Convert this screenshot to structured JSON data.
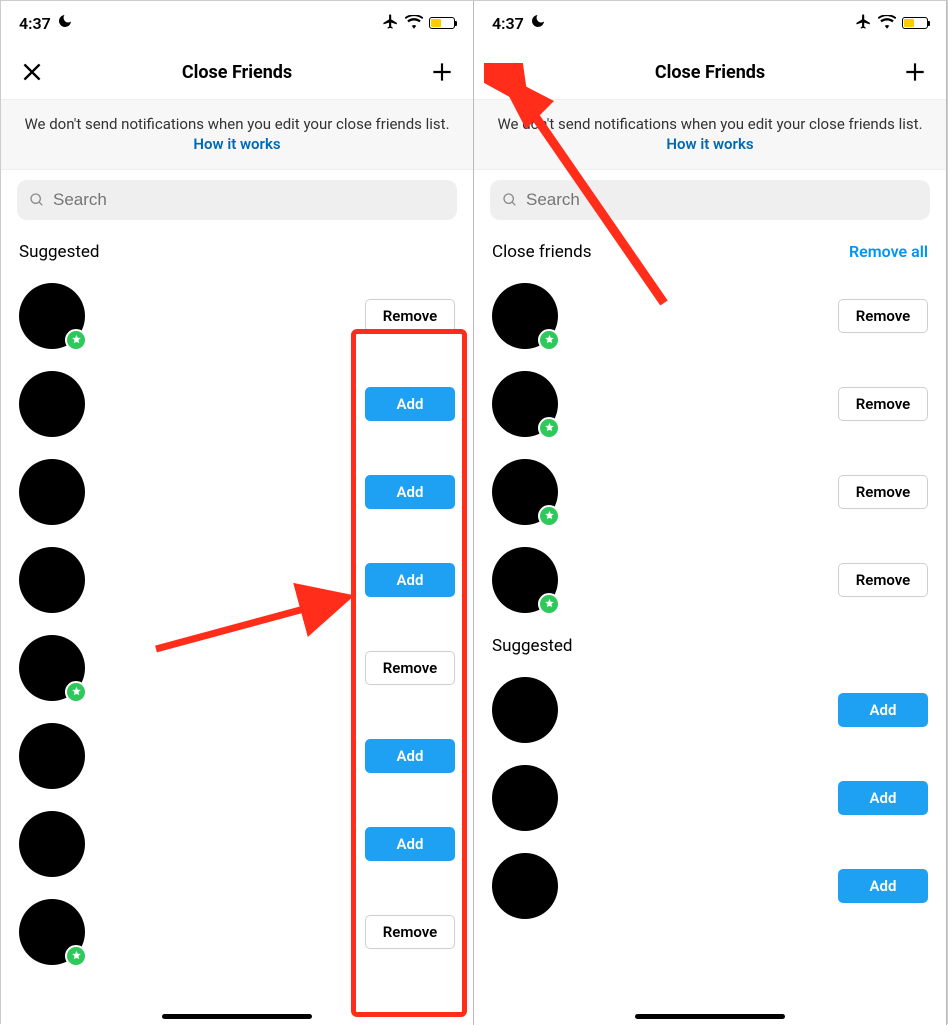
{
  "status": {
    "time": "4:37"
  },
  "nav": {
    "title": "Close Friends"
  },
  "notice": {
    "text": "We don't send notifications when you edit your close friends list. ",
    "link": "How it works"
  },
  "search": {
    "placeholder": "Search"
  },
  "left": {
    "section": "Suggested",
    "rows": [
      {
        "action": "Remove",
        "badge": true
      },
      {
        "action": "Add",
        "badge": false
      },
      {
        "action": "Add",
        "badge": false
      },
      {
        "action": "Add",
        "badge": false
      },
      {
        "action": "Remove",
        "badge": true
      },
      {
        "action": "Add",
        "badge": false
      },
      {
        "action": "Add",
        "badge": false
      },
      {
        "action": "Remove",
        "badge": true
      }
    ]
  },
  "right": {
    "section1": "Close friends",
    "remove_all": "Remove all",
    "rows1": [
      {
        "action": "Remove",
        "badge": true
      },
      {
        "action": "Remove",
        "badge": true
      },
      {
        "action": "Remove",
        "badge": true
      },
      {
        "action": "Remove",
        "badge": true
      }
    ],
    "section2": "Suggested",
    "rows2": [
      {
        "action": "Add",
        "badge": false
      },
      {
        "action": "Add",
        "badge": false
      },
      {
        "action": "Add",
        "badge": false
      }
    ]
  },
  "labels": {
    "add": "Add",
    "remove": "Remove"
  }
}
